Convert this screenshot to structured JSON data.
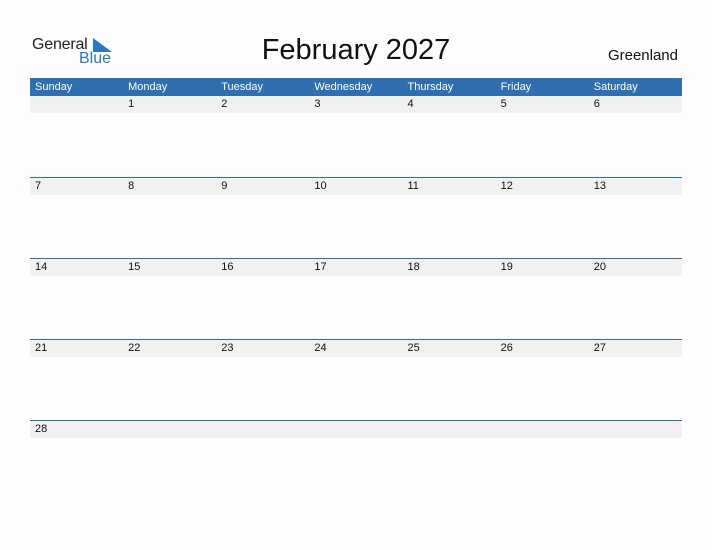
{
  "logo": {
    "text_general": "General",
    "text_blue": "Blue",
    "icon": "blue-triangle-flag"
  },
  "title": "February 2027",
  "country": "Greenland",
  "colors": {
    "accent": "#2f6eaf",
    "logo_blue": "#2a78c2",
    "date_strip": "#f1f1f1"
  },
  "weekdays": [
    "Sunday",
    "Monday",
    "Tuesday",
    "Wednesday",
    "Thursday",
    "Friday",
    "Saturday"
  ],
  "weeks": [
    [
      "",
      "1",
      "2",
      "3",
      "4",
      "5",
      "6"
    ],
    [
      "7",
      "8",
      "9",
      "10",
      "11",
      "12",
      "13"
    ],
    [
      "14",
      "15",
      "16",
      "17",
      "18",
      "19",
      "20"
    ],
    [
      "21",
      "22",
      "23",
      "24",
      "25",
      "26",
      "27"
    ],
    [
      "28",
      "",
      "",
      "",
      "",
      "",
      ""
    ]
  ]
}
